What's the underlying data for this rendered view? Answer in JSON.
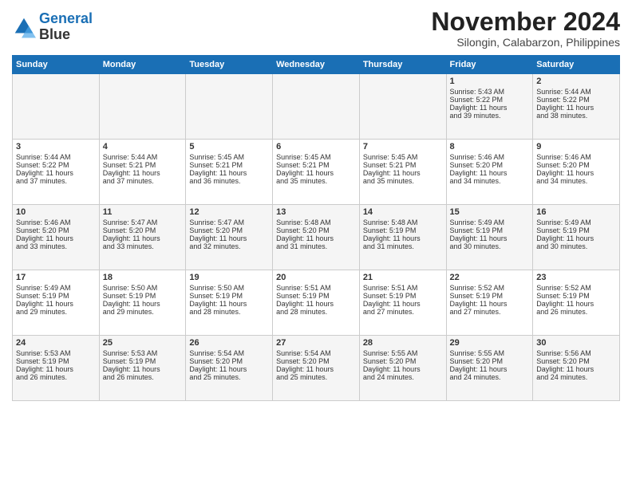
{
  "header": {
    "logo_line1": "General",
    "logo_line2": "Blue",
    "month_title": "November 2024",
    "location": "Silongin, Calabarzon, Philippines"
  },
  "days_of_week": [
    "Sunday",
    "Monday",
    "Tuesday",
    "Wednesday",
    "Thursday",
    "Friday",
    "Saturday"
  ],
  "weeks": [
    [
      {
        "day": "",
        "info": ""
      },
      {
        "day": "",
        "info": ""
      },
      {
        "day": "",
        "info": ""
      },
      {
        "day": "",
        "info": ""
      },
      {
        "day": "",
        "info": ""
      },
      {
        "day": "1",
        "info": "Sunrise: 5:43 AM\nSunset: 5:22 PM\nDaylight: 11 hours\nand 39 minutes."
      },
      {
        "day": "2",
        "info": "Sunrise: 5:44 AM\nSunset: 5:22 PM\nDaylight: 11 hours\nand 38 minutes."
      }
    ],
    [
      {
        "day": "3",
        "info": "Sunrise: 5:44 AM\nSunset: 5:22 PM\nDaylight: 11 hours\nand 37 minutes."
      },
      {
        "day": "4",
        "info": "Sunrise: 5:44 AM\nSunset: 5:21 PM\nDaylight: 11 hours\nand 37 minutes."
      },
      {
        "day": "5",
        "info": "Sunrise: 5:45 AM\nSunset: 5:21 PM\nDaylight: 11 hours\nand 36 minutes."
      },
      {
        "day": "6",
        "info": "Sunrise: 5:45 AM\nSunset: 5:21 PM\nDaylight: 11 hours\nand 35 minutes."
      },
      {
        "day": "7",
        "info": "Sunrise: 5:45 AM\nSunset: 5:21 PM\nDaylight: 11 hours\nand 35 minutes."
      },
      {
        "day": "8",
        "info": "Sunrise: 5:46 AM\nSunset: 5:20 PM\nDaylight: 11 hours\nand 34 minutes."
      },
      {
        "day": "9",
        "info": "Sunrise: 5:46 AM\nSunset: 5:20 PM\nDaylight: 11 hours\nand 34 minutes."
      }
    ],
    [
      {
        "day": "10",
        "info": "Sunrise: 5:46 AM\nSunset: 5:20 PM\nDaylight: 11 hours\nand 33 minutes."
      },
      {
        "day": "11",
        "info": "Sunrise: 5:47 AM\nSunset: 5:20 PM\nDaylight: 11 hours\nand 33 minutes."
      },
      {
        "day": "12",
        "info": "Sunrise: 5:47 AM\nSunset: 5:20 PM\nDaylight: 11 hours\nand 32 minutes."
      },
      {
        "day": "13",
        "info": "Sunrise: 5:48 AM\nSunset: 5:20 PM\nDaylight: 11 hours\nand 31 minutes."
      },
      {
        "day": "14",
        "info": "Sunrise: 5:48 AM\nSunset: 5:19 PM\nDaylight: 11 hours\nand 31 minutes."
      },
      {
        "day": "15",
        "info": "Sunrise: 5:49 AM\nSunset: 5:19 PM\nDaylight: 11 hours\nand 30 minutes."
      },
      {
        "day": "16",
        "info": "Sunrise: 5:49 AM\nSunset: 5:19 PM\nDaylight: 11 hours\nand 30 minutes."
      }
    ],
    [
      {
        "day": "17",
        "info": "Sunrise: 5:49 AM\nSunset: 5:19 PM\nDaylight: 11 hours\nand 29 minutes."
      },
      {
        "day": "18",
        "info": "Sunrise: 5:50 AM\nSunset: 5:19 PM\nDaylight: 11 hours\nand 29 minutes."
      },
      {
        "day": "19",
        "info": "Sunrise: 5:50 AM\nSunset: 5:19 PM\nDaylight: 11 hours\nand 28 minutes."
      },
      {
        "day": "20",
        "info": "Sunrise: 5:51 AM\nSunset: 5:19 PM\nDaylight: 11 hours\nand 28 minutes."
      },
      {
        "day": "21",
        "info": "Sunrise: 5:51 AM\nSunset: 5:19 PM\nDaylight: 11 hours\nand 27 minutes."
      },
      {
        "day": "22",
        "info": "Sunrise: 5:52 AM\nSunset: 5:19 PM\nDaylight: 11 hours\nand 27 minutes."
      },
      {
        "day": "23",
        "info": "Sunrise: 5:52 AM\nSunset: 5:19 PM\nDaylight: 11 hours\nand 26 minutes."
      }
    ],
    [
      {
        "day": "24",
        "info": "Sunrise: 5:53 AM\nSunset: 5:19 PM\nDaylight: 11 hours\nand 26 minutes."
      },
      {
        "day": "25",
        "info": "Sunrise: 5:53 AM\nSunset: 5:19 PM\nDaylight: 11 hours\nand 26 minutes."
      },
      {
        "day": "26",
        "info": "Sunrise: 5:54 AM\nSunset: 5:20 PM\nDaylight: 11 hours\nand 25 minutes."
      },
      {
        "day": "27",
        "info": "Sunrise: 5:54 AM\nSunset: 5:20 PM\nDaylight: 11 hours\nand 25 minutes."
      },
      {
        "day": "28",
        "info": "Sunrise: 5:55 AM\nSunset: 5:20 PM\nDaylight: 11 hours\nand 24 minutes."
      },
      {
        "day": "29",
        "info": "Sunrise: 5:55 AM\nSunset: 5:20 PM\nDaylight: 11 hours\nand 24 minutes."
      },
      {
        "day": "30",
        "info": "Sunrise: 5:56 AM\nSunset: 5:20 PM\nDaylight: 11 hours\nand 24 minutes."
      }
    ]
  ]
}
